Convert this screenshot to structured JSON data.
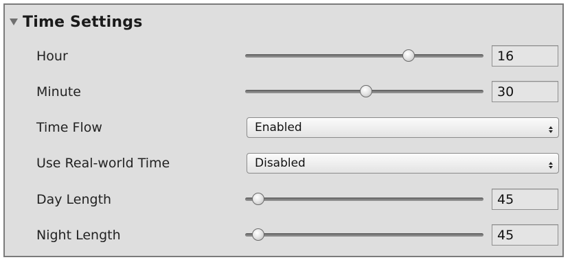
{
  "panel": {
    "title": "Time Settings",
    "foldout_icon": "triangle-down-icon"
  },
  "fields": {
    "hour": {
      "label": "Hour",
      "value": "16",
      "min": 0,
      "max": 23
    },
    "minute": {
      "label": "Minute",
      "value": "30",
      "min": 0,
      "max": 59
    },
    "time_flow": {
      "label": "Time Flow",
      "selected": "Enabled"
    },
    "real_world_time": {
      "label": "Use Real-world Time",
      "selected": "Disabled"
    },
    "day_length": {
      "label": "Day Length",
      "value": "45",
      "min": 0,
      "max": 1440
    },
    "night_length": {
      "label": "Night Length",
      "value": "45",
      "min": 0,
      "max": 1440
    }
  },
  "icons": {
    "dropdown": "up-down-arrows-icon",
    "slider_thumb": "slider-knob"
  },
  "colors": {
    "panel_bg": "#dedede",
    "border": "#7a7a7a",
    "field_bg": "#e4e4e4"
  }
}
